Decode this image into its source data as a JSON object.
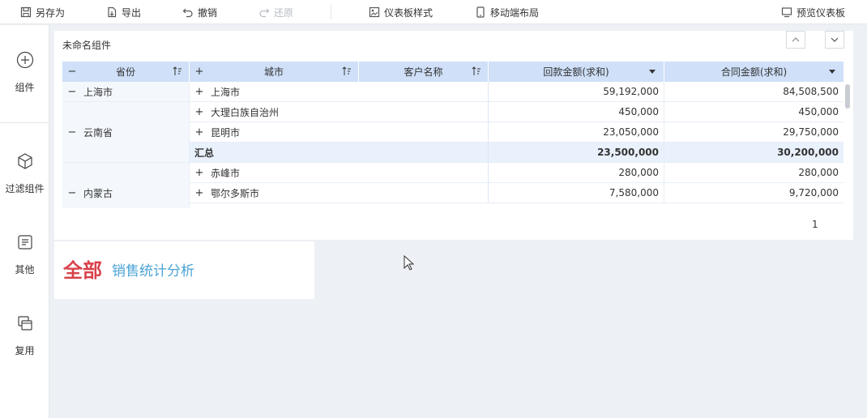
{
  "toolbar": {
    "save_as": "另存为",
    "export": "导出",
    "undo": "撤销",
    "redo": "还原",
    "dashboard_style": "仪表板样式",
    "mobile_layout": "移动端布局",
    "preview": "预览仪表板"
  },
  "sidebar": {
    "items": [
      {
        "label": "组件",
        "icon": "plus-circle-icon"
      },
      {
        "label": "过滤组件",
        "icon": "cube-icon"
      },
      {
        "label": "其他",
        "icon": "document-icon"
      },
      {
        "label": "复用",
        "icon": "copy-icon"
      }
    ]
  },
  "widget": {
    "title": "未命名组件",
    "headers": {
      "province": "省份",
      "city": "城市",
      "customer": "客户名称",
      "payment": "回款金额(求和)",
      "contract": "合同金额(求和)"
    },
    "rows": [
      {
        "city": "上海市",
        "payment": "59,192,000",
        "contract": "84,508,500"
      },
      {
        "city": "大理白族自治州",
        "payment": "450,000",
        "contract": "450,000"
      },
      {
        "city": "昆明市",
        "payment": "23,050,000",
        "contract": "29,750,000"
      },
      {
        "city": "汇总",
        "payment": "23,500,000",
        "contract": "30,200,000"
      },
      {
        "city": "赤峰市",
        "payment": "280,000",
        "contract": "280,000"
      },
      {
        "city": "鄂尔多斯市",
        "payment": "7,580,000",
        "contract": "9,720,000"
      }
    ],
    "provinces": [
      "上海市",
      "云南省",
      "内蒙古"
    ],
    "page": "1"
  },
  "text_widget": {
    "big": "全部",
    "small": "销售统计分析"
  },
  "colors": {
    "header_bg": "#cfe0f8",
    "row_alt_bg": "#f4f8fd",
    "summary_bg": "#e9f1fc",
    "accent_red": "#d9414a",
    "accent_blue": "#4aa3d6"
  }
}
